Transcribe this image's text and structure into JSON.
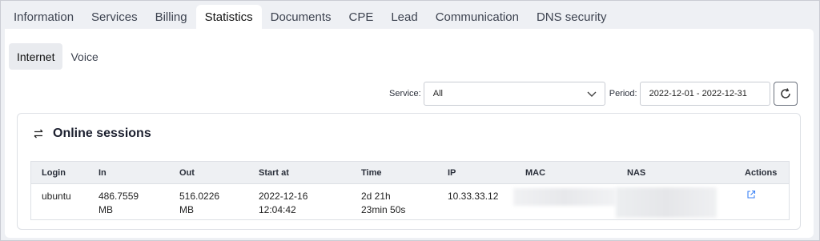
{
  "top_tabs": [
    "Information",
    "Services",
    "Billing",
    "Statistics",
    "Documents",
    "CPE",
    "Lead",
    "Communication",
    "DNS security"
  ],
  "active_top_tab": "Statistics",
  "sub_tabs": [
    "Internet",
    "Voice"
  ],
  "active_sub_tab": "Internet",
  "filters": {
    "service_label": "Service:",
    "service_value": "All",
    "period_label": "Period:",
    "period_value": "2022-12-01 - 2022-12-31"
  },
  "card": {
    "title": "Online sessions"
  },
  "table": {
    "columns": [
      "Login",
      "In",
      "Out",
      "Start at",
      "Time",
      "IP",
      "MAC",
      "NAS",
      "Actions"
    ],
    "rows": [
      {
        "login": "ubuntu",
        "in_value": "486.7559",
        "in_unit": "MB",
        "out_value": "516.0226",
        "out_unit": "MB",
        "start_date": "2022-12-16",
        "start_time": "12:04:42",
        "time_line1": "2d 21h",
        "time_line2": "23min 50s",
        "ip": "10.33.33.12"
      }
    ]
  },
  "colors": {
    "accent": "#3b82f6",
    "page_bg": "#eef0f4",
    "table_header_bg": "#eef0f3"
  },
  "icons": {
    "card": "arrows-exchange-icon",
    "refresh": "refresh-icon",
    "action": "external-link-icon",
    "select": "chevron-down-icon"
  }
}
